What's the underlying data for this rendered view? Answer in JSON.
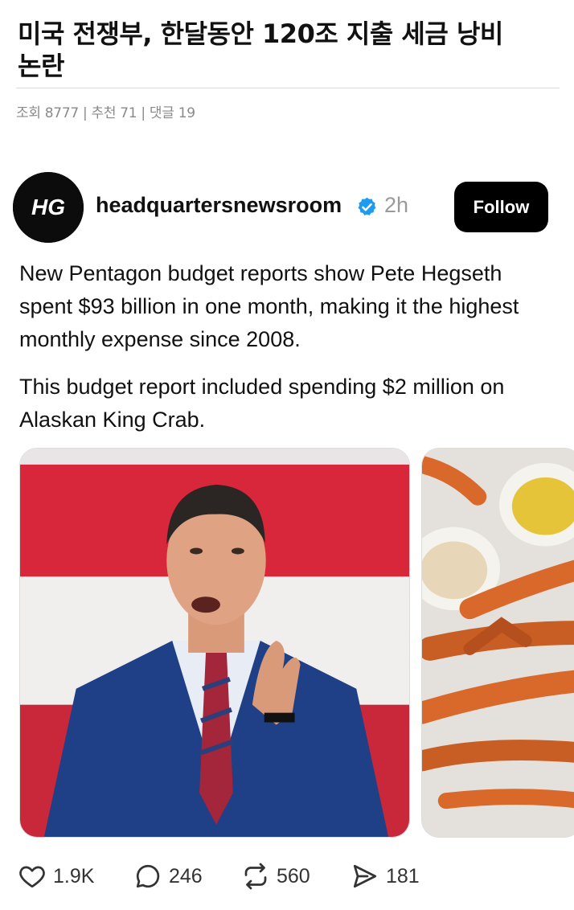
{
  "article": {
    "title": "미국 전쟁부, 한달동안 120조 지출 세금 낭비 논란",
    "meta": "조회 8777 | 추천 71 | 댓글 19"
  },
  "post": {
    "avatar_text": "HG",
    "username": "headquartersnewsroom",
    "time": "2h",
    "follow_label": "Follow",
    "paragraph1": "New Pentagon budget reports show Pete Hegseth spent $93 billion in one month, making it the highest monthly expense since 2008.",
    "paragraph2": "This budget report included spending $2 million on Alaskan King Crab."
  },
  "actions": {
    "likes": "1.9K",
    "replies": "246",
    "reposts": "560",
    "shares": "181"
  },
  "colors": {
    "verified": "#1d9bf0",
    "follow_bg": "#000000",
    "flag_red": "#d8263a",
    "suit_blue": "#1f3f86",
    "crab_orange": "#d9692b"
  },
  "icons": [
    "heart-icon",
    "reply-icon",
    "repost-icon",
    "share-icon",
    "verified-badge-icon"
  ]
}
